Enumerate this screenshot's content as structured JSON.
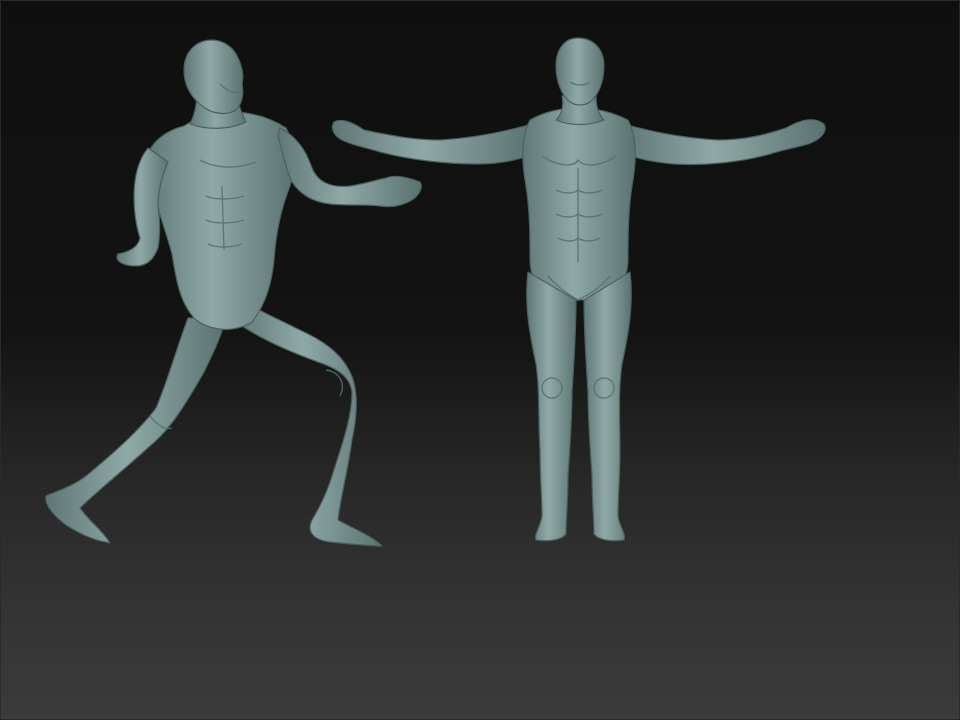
{
  "viewport": {
    "background_top": "#0f0f0f",
    "background_bottom": "#3b3b3b",
    "model_color": "#7f9b98",
    "model_shadow": "#4f6664",
    "model_highlight": "#aac2bf"
  },
  "models": [
    {
      "pose": "action-lunge"
    },
    {
      "pose": "t-pose"
    }
  ]
}
